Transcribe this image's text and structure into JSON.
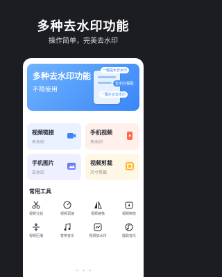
{
  "promo": {
    "title": "多种去水印功能",
    "subtitle": "操作简单，完美去水印"
  },
  "banner": {
    "title": "多种去水印功能",
    "subtitle": "不限使用",
    "chips": [
      "一键提水去水印",
      "去水印/提取",
      "一图片合去水印"
    ],
    "gradient": [
      "#6fb3ff",
      "#3a86f7"
    ]
  },
  "features": [
    {
      "title": "视频链接",
      "subtitle": "去水印",
      "icon": "video-link-icon",
      "color": "#3a86f7"
    },
    {
      "title": "手机视频",
      "subtitle": "去水印",
      "icon": "phone-video-icon",
      "color": "#ff6a4d"
    },
    {
      "title": "手机图片",
      "subtitle": "去水印",
      "icon": "image-icon",
      "color": "#6b7cf7"
    },
    {
      "title": "视频剪裁",
      "subtitle": "尺寸剪裁",
      "icon": "crop-icon",
      "color": "#ffb32b"
    }
  ],
  "tools": {
    "title": "常用工具",
    "items": [
      {
        "label": "视频分割",
        "icon": "scissors-icon"
      },
      {
        "label": "视频调速",
        "icon": "speed-dial-icon"
      },
      {
        "label": "视频镜像",
        "icon": "mirror-icon"
      },
      {
        "label": "视频倒放",
        "icon": "reverse-play-icon"
      },
      {
        "label": "视频压缩",
        "icon": "compress-icon"
      },
      {
        "label": "替换音乐",
        "icon": "music-icon"
      },
      {
        "label": "视频加水印",
        "icon": "add-watermark-icon"
      },
      {
        "label": "提取音乐",
        "icon": "extract-music-icon"
      }
    ]
  }
}
